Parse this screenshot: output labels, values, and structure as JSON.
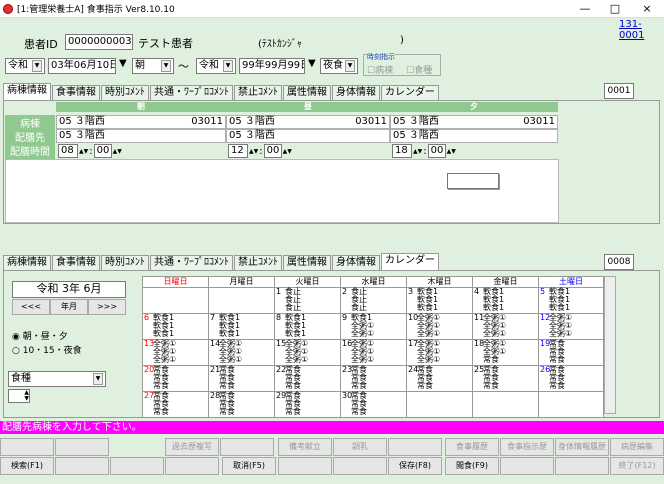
{
  "window": {
    "title": "[1:管理栄養士A] 食事指示 Ver8.10.10",
    "minimize": "—",
    "maximize": "□",
    "close": "×"
  },
  "code_link": "131-0001",
  "patient": {
    "id_label": "患者ID",
    "id": "000000000303",
    "name": "テスト患者",
    "kana": "(ﾃｽﾄｶﾝｼﾞｬ",
    "kana_close": ")"
  },
  "period": {
    "era_from": "令和",
    "date_from": "03年06月10日",
    "meal_from": "朝",
    "tilde": "～",
    "era_to": "令和",
    "date_to": "99年99月99日",
    "meal_to": "夜食"
  },
  "time_instruction": {
    "title": "時刻指示",
    "ward": "病棟",
    "meal": "食種"
  },
  "top_tabs": [
    "病棟情報",
    "食事情報",
    "時別ｺﾒﾝﾄ",
    "共通・ﾜｰﾌﾟﾛｺﾒﾝﾄ",
    "禁止ｺﾒﾝﾄ",
    "属性情報",
    "身体情報",
    "カレンダー"
  ],
  "top_code": "0001",
  "grid": {
    "columns": [
      "朝",
      "昼",
      "夕"
    ],
    "rows": [
      {
        "label": "病棟",
        "cells": [
          {
            "left": "05 ３階西",
            "right": "03011"
          },
          {
            "left": "05 ３階西",
            "right": "03011"
          },
          {
            "left": "05 ３階西",
            "right": "03011"
          }
        ]
      },
      {
        "label": "配膳先",
        "cells": [
          {
            "left": "05 ３階西",
            "right": ""
          },
          {
            "left": "05 ３階西",
            "right": ""
          },
          {
            "left": "05 ３階西",
            "right": ""
          }
        ]
      },
      {
        "label": "配膳時間",
        "cells": [
          {
            "left": "08",
            "right": "00"
          },
          {
            "left": "12",
            "right": "00"
          },
          {
            "left": "18",
            "right": "00"
          }
        ]
      }
    ]
  },
  "bottom_tabs": [
    "病棟情報",
    "食事情報",
    "時別ｺﾒﾝﾄ",
    "共通・ﾜｰﾌﾟﾛｺﾒﾝﾄ",
    "禁止ｺﾒﾝﾄ",
    "属性情報",
    "身体情報",
    "カレンダー"
  ],
  "bottom_code": "0008",
  "calendar_nav": {
    "month": "令和 3年 6月",
    "prev": "<<<",
    "month_btn": "年月",
    "next": ">>>"
  },
  "radio": {
    "opt1": "朝・昼・夕",
    "opt2": "10・15・夜食"
  },
  "food_type_label": "食種",
  "calendar": {
    "weekdays": [
      "日曜日",
      "月曜日",
      "火曜日",
      "水曜日",
      "木曜日",
      "金曜日",
      "土曜日"
    ],
    "weeks": [
      [
        {
          "d": "",
          "l": []
        },
        {
          "d": "",
          "l": []
        },
        {
          "d": "1",
          "l": [
            "食止",
            "食止",
            "食止"
          ]
        },
        {
          "d": "2",
          "l": [
            "食止",
            "食止",
            "食止"
          ]
        },
        {
          "d": "3",
          "l": [
            "軟食1",
            "軟食1",
            "軟食1"
          ]
        },
        {
          "d": "4",
          "l": [
            "軟食1",
            "軟食1",
            "軟食1"
          ]
        },
        {
          "d": "5",
          "l": [
            "軟食1",
            "軟食1",
            "軟食1"
          ]
        }
      ],
      [
        {
          "d": "6",
          "l": [
            "軟食1",
            "軟食1",
            "軟食1"
          ]
        },
        {
          "d": "7",
          "l": [
            "軟食1",
            "軟食1",
            "軟食1"
          ]
        },
        {
          "d": "8",
          "l": [
            "軟食1",
            "軟食1",
            "軟食1"
          ]
        },
        {
          "d": "9",
          "l": [
            "軟食1",
            "全粥①",
            "全粥①"
          ]
        },
        {
          "d": "10",
          "l": [
            "全粥①",
            "全粥①",
            "全粥①"
          ]
        },
        {
          "d": "11",
          "l": [
            "全粥①",
            "全粥①",
            "全粥①"
          ]
        },
        {
          "d": "12",
          "l": [
            "全粥①",
            "全粥①",
            "全粥①"
          ]
        }
      ],
      [
        {
          "d": "13",
          "l": [
            "全粥①",
            "全粥①",
            "全粥①"
          ]
        },
        {
          "d": "14",
          "l": [
            "全粥①",
            "全粥①",
            "全粥①"
          ]
        },
        {
          "d": "15",
          "l": [
            "全粥①",
            "全粥①",
            "全粥①"
          ]
        },
        {
          "d": "16",
          "l": [
            "全粥①",
            "全粥①",
            "全粥①"
          ]
        },
        {
          "d": "17",
          "l": [
            "全粥①",
            "全粥①",
            "全粥①"
          ]
        },
        {
          "d": "18",
          "l": [
            "全粥①",
            "全粥①",
            "常食"
          ]
        },
        {
          "d": "19",
          "l": [
            "常食",
            "常食",
            "常食"
          ]
        }
      ],
      [
        {
          "d": "20",
          "l": [
            "常食",
            "常食",
            "常食"
          ]
        },
        {
          "d": "21",
          "l": [
            "常食",
            "常食",
            "常食"
          ]
        },
        {
          "d": "22",
          "l": [
            "常食",
            "常食",
            "常食"
          ]
        },
        {
          "d": "23",
          "l": [
            "常食",
            "常食",
            "常食"
          ]
        },
        {
          "d": "24",
          "l": [
            "常食",
            "常食",
            "常食"
          ]
        },
        {
          "d": "25",
          "l": [
            "常食",
            "常食",
            "常食"
          ]
        },
        {
          "d": "26",
          "l": [
            "常食",
            "常食",
            "常食"
          ]
        }
      ],
      [
        {
          "d": "27",
          "l": [
            "常食",
            "常食",
            "常食"
          ]
        },
        {
          "d": "28",
          "l": [
            "常食",
            "常食",
            "常食"
          ]
        },
        {
          "d": "29",
          "l": [
            "常食",
            "常食",
            "常食"
          ]
        },
        {
          "d": "30",
          "l": [
            "常食",
            "常食",
            "常食"
          ]
        },
        {
          "d": "",
          "l": []
        },
        {
          "d": "",
          "l": []
        },
        {
          "d": "",
          "l": []
        }
      ]
    ]
  },
  "status_message": "配膳先病棟を入力して下さい。",
  "buttons_row1": [
    "",
    "",
    "過去歴複写",
    "",
    "備考献立",
    "調乳",
    "",
    "食事履歴",
    "食事指示歴",
    "身体情報履歴",
    "病歴編集"
  ],
  "buttons_row2": [
    "検索(F1)",
    "",
    "",
    "",
    "取消(F5)",
    "",
    "",
    "保存(F8)",
    "閲食(F9)",
    "",
    "",
    "終了(F12)"
  ],
  "colors": {
    "bg": "#dff0df",
    "header": "#8fc98f",
    "status": "#ff00ff",
    "sunday": "#ff0000",
    "saturday": "#0000ff"
  }
}
